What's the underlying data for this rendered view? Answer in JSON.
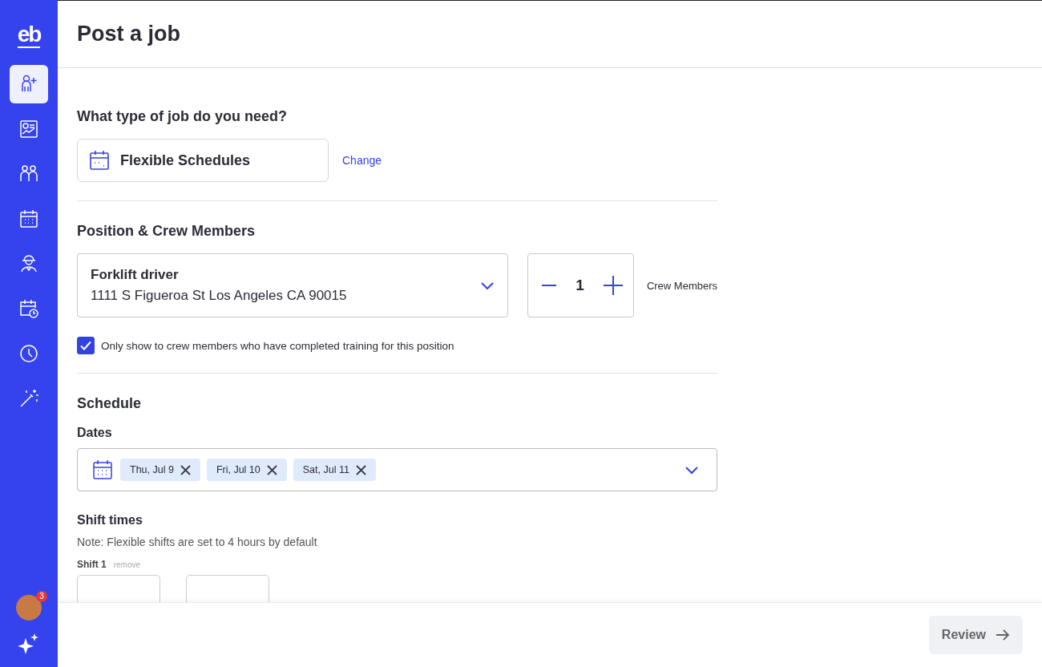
{
  "sidebar": {
    "logo": "eb",
    "nav_items": [
      {
        "selected": true
      },
      {
        "selected": false
      },
      {
        "selected": false
      },
      {
        "selected": false
      },
      {
        "selected": false
      },
      {
        "selected": false
      },
      {
        "selected": false
      },
      {
        "selected": false
      }
    ],
    "notification_count": "3"
  },
  "header": {
    "title": "Post a job"
  },
  "job_type": {
    "heading": "What type of job do you need?",
    "value": "Flexible Schedules",
    "change_link": "Change"
  },
  "position": {
    "heading": "Position & Crew Members",
    "role": "Forklift driver",
    "address": "1111 S Figueroa St Los Angeles CA 90015",
    "crew_count": "1",
    "crew_label": "Crew Members",
    "training_only": {
      "label": "Only show to crew members who have completed training for this position",
      "checked": true
    }
  },
  "schedule": {
    "heading": "Schedule",
    "dates_label": "Dates",
    "dates": [
      "Thu, Jul 9",
      "Fri, Jul 10",
      "Sat, Jul 11"
    ],
    "shift_heading": "Shift times",
    "note": "Note: Flexible shifts are set to 4 hours by default",
    "shift_label": "Shift 1",
    "remove_link": "remove"
  },
  "footer": {
    "review_button": {
      "label": "Review",
      "disabled": true
    }
  }
}
